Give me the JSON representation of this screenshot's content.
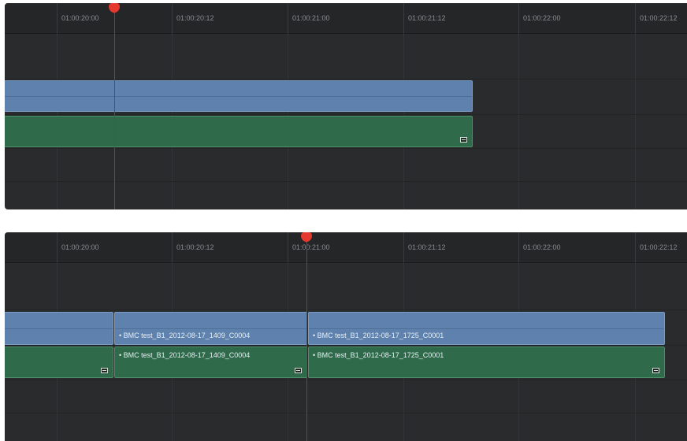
{
  "timecodes": [
    "01:00:20:00",
    "01:00:20:12",
    "01:00:21:00",
    "01:00:21:12",
    "01:00:22:00",
    "01:00:22:12"
  ],
  "colors": {
    "panel_bg": "#2a2b2d",
    "video_clip": "#5e82ad",
    "audio_clip": "#2f6a4a",
    "playhead": "#e5392e"
  },
  "top_panel": {
    "playhead_timecode": "01:00:20:00",
    "clips": []
  },
  "bottom_panel": {
    "playhead_timecode": "01:00:21:00",
    "clips": [
      {
        "video_label": "• BMC test_B1_2012-08-17_1409_C0004",
        "audio_label": "• BMC test_B1_2012-08-17_1409_C0004"
      },
      {
        "video_label": "• BMC test_B1_2012-08-17_1725_C0001",
        "audio_label": "• BMC test_B1_2012-08-17_1725_C0001"
      }
    ]
  }
}
